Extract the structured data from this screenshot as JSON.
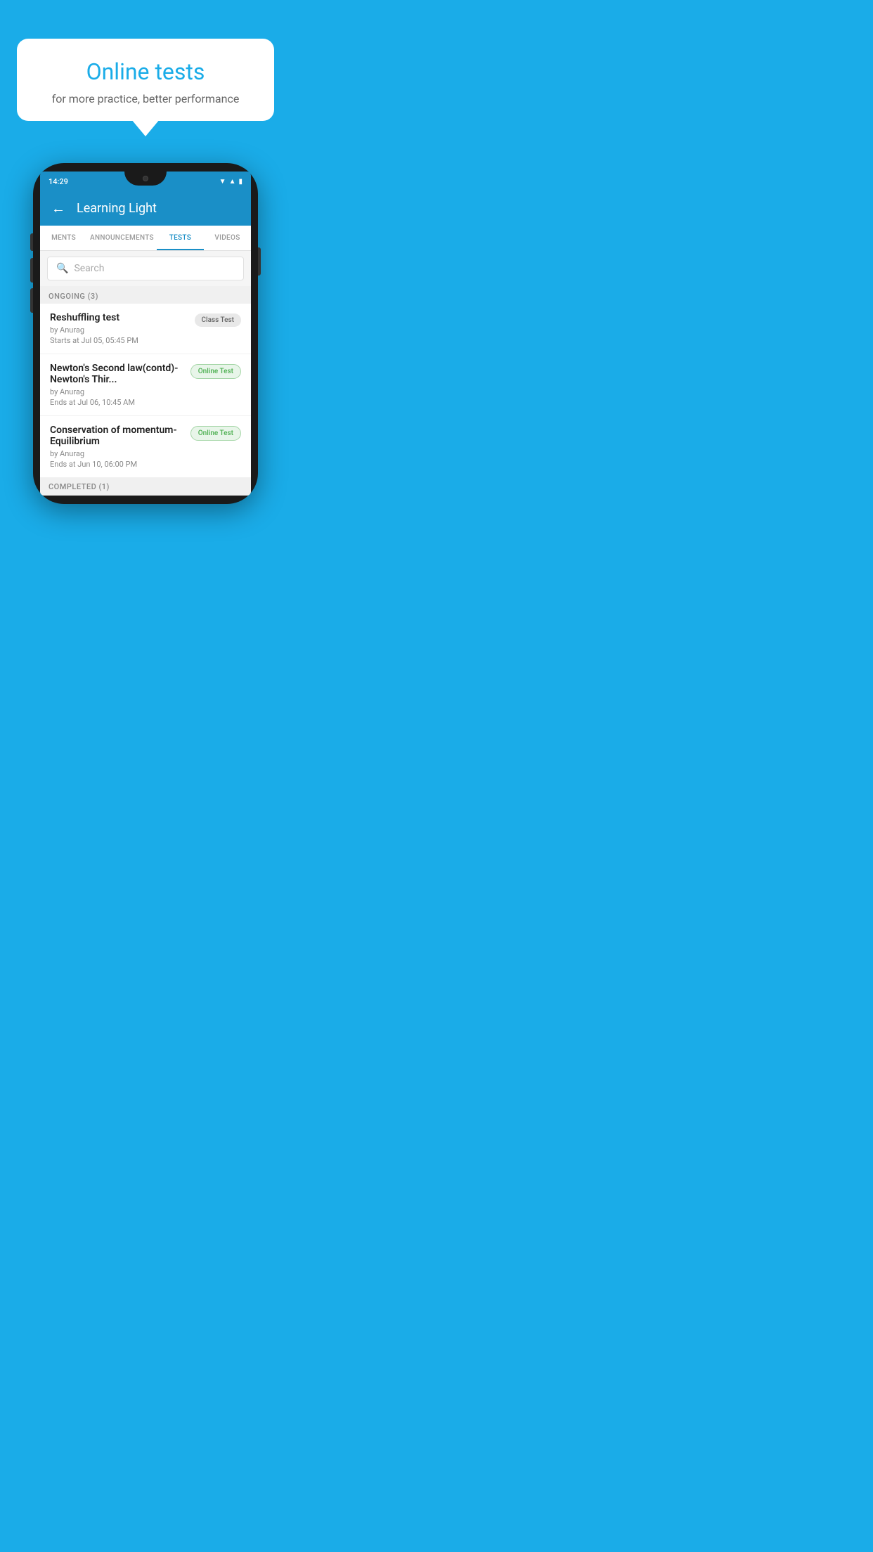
{
  "background_color": "#1AACE8",
  "speech_bubble": {
    "title": "Online tests",
    "subtitle": "for more practice, better performance"
  },
  "phone": {
    "status_bar": {
      "time": "14:29",
      "icons": [
        "wifi",
        "signal",
        "battery"
      ]
    },
    "header": {
      "title": "Learning Light",
      "back_label": "←"
    },
    "tabs": [
      {
        "label": "MENTS",
        "active": false
      },
      {
        "label": "ANNOUNCEMENTS",
        "active": false
      },
      {
        "label": "TESTS",
        "active": true
      },
      {
        "label": "VIDEOS",
        "active": false
      }
    ],
    "search": {
      "placeholder": "Search"
    },
    "sections": [
      {
        "header": "ONGOING (3)",
        "tests": [
          {
            "name": "Reshuffling test",
            "author": "by Anurag",
            "date": "Starts at  Jul 05, 05:45 PM",
            "badge": "Class Test",
            "badge_type": "class"
          },
          {
            "name": "Newton's Second law(contd)-Newton's Thir...",
            "author": "by Anurag",
            "date": "Ends at  Jul 06, 10:45 AM",
            "badge": "Online Test",
            "badge_type": "online"
          },
          {
            "name": "Conservation of momentum-Equilibrium",
            "author": "by Anurag",
            "date": "Ends at  Jun 10, 06:00 PM",
            "badge": "Online Test",
            "badge_type": "online"
          }
        ]
      }
    ],
    "completed_header": "COMPLETED (1)"
  }
}
